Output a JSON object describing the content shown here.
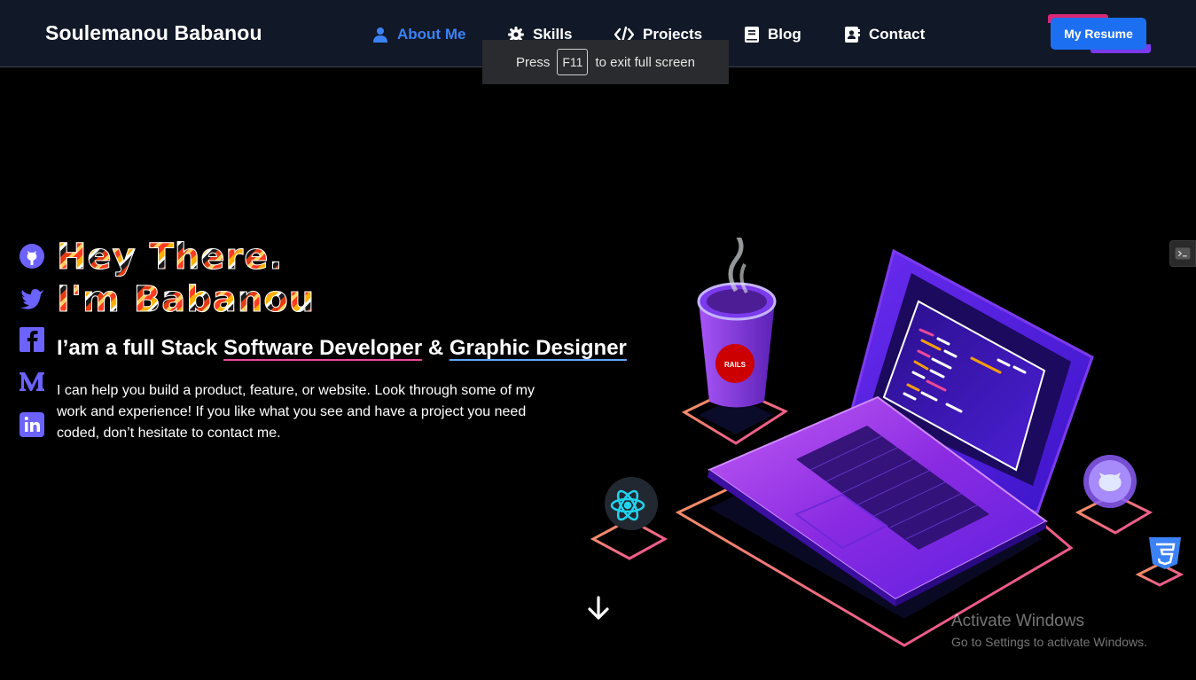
{
  "header": {
    "brand": "Soulemanou Babanou",
    "nav": [
      {
        "label": "About Me",
        "icon": "user-icon",
        "active": true
      },
      {
        "label": "Skills",
        "icon": "gear-icon"
      },
      {
        "label": "Projects",
        "icon": "code-icon"
      },
      {
        "label": "Blog",
        "icon": "book-icon"
      },
      {
        "label": "Contact",
        "icon": "contact-card-icon"
      }
    ],
    "resume_label": "My Resume"
  },
  "toast": {
    "prefix": "Press",
    "key": "F11",
    "suffix": "to exit full screen"
  },
  "social": [
    "github-icon",
    "twitter-icon",
    "facebook-icon",
    "medium-icon",
    "linkedin-icon"
  ],
  "hero": {
    "line1": "Hey There.",
    "line2": "I'm Babanou",
    "subtitle_prefix": "I’am a full Stack ",
    "subtitle_role1": "Software Developer",
    "subtitle_and": " & ",
    "subtitle_role2": "Graphic Designer",
    "description": "I can help you build a product, feature, or website. Look through some of my work and experience! If you like what you see and have a project you need coded, don’t hesitate to contact me."
  },
  "illustration": {
    "cup_badge": "RAILS",
    "icons": [
      "react-icon",
      "github-icon",
      "css3-icon"
    ]
  },
  "watermark": {
    "title": "Activate Windows",
    "subtitle": "Go to Settings to activate Windows."
  },
  "colors": {
    "header_bg": "#111827",
    "accent_blue": "#3b82f6",
    "resume_button": "#1d6ff2",
    "underline_pink": "#ec4899",
    "underline_blue": "#60a5fa"
  }
}
